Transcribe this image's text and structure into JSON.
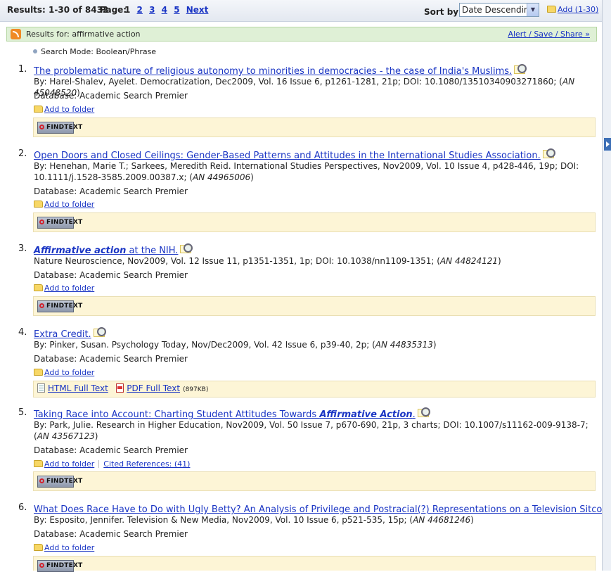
{
  "topbar": {
    "results_label": "Results: 1-30 of 8432",
    "page_label": "Page:",
    "pages": [
      "1",
      "2",
      "3",
      "4",
      "5"
    ],
    "next_label": "Next",
    "sort_label": "Sort by:",
    "sort_value": "Date Descending",
    "add_label": "Add (1-30)"
  },
  "results_for": {
    "label": "Results for:",
    "query": "affirmative action",
    "alert_label": "Alert / Save / Share »"
  },
  "search_mode": "Search Mode: Boolean/Phrase",
  "labels": {
    "database_prefix": "Database:",
    "add_to_folder": "Add to folder",
    "find_text": "FINDTEXT",
    "html_full_text": "HTML Full Text",
    "pdf_full_text": "PDF Full Text",
    "pdf_size": "(897KB)",
    "cited_references": "Cited References: (41)"
  },
  "results": [
    {
      "num": "1.",
      "title": "The problematic nature of religious autonomy to minorities in democracies - the case of India's Muslims.",
      "cite": "By: Harel-Shalev, Ayelet. Democratization, Dec2009, Vol. 16 Issue 6, p1261-1281, 21p; DOI: 10.1080/13510340903271860; (",
      "an": "AN 45048520",
      "database": "Academic Search Premier"
    },
    {
      "num": "2.",
      "title": "Open Doors and Closed Ceilings: Gender-Based Patterns and Attitudes in the International Studies Association.",
      "cite": "By: Henehan, Marie T.; Sarkees, Meredith Reid. International Studies Perspectives, Nov2009, Vol. 10 Issue 4, p428-446, 19p; DOI: 10.1111/j.1528-3585.2009.00387.x; (",
      "an": "AN 44965006",
      "database": "Academic Search Premier"
    },
    {
      "num": "3.",
      "title_hl": "Affirmative action",
      "title_rest": " at the NIH.",
      "cite": "Nature Neuroscience, Nov2009, Vol. 12 Issue 11, p1351-1351, 1p; DOI: 10.1038/nn1109-1351; (",
      "an": "AN 44824121",
      "database": "Academic Search Premier"
    },
    {
      "num": "4.",
      "title": "Extra Credit.",
      "cite": "By: Pinker, Susan. Psychology Today, Nov/Dec2009, Vol. 42 Issue 6, p39-40, 2p; (",
      "an": "AN 44835313",
      "database": "Academic Search Premier"
    },
    {
      "num": "5.",
      "title_pre": "Taking Race into Account: Charting Student Attitudes Towards ",
      "title_hl": "Affirmative Action",
      "title_rest": ".",
      "cite": "By: Park, Julie. Research in Higher Education, Nov2009, Vol. 50 Issue 7, p670-690, 21p, 3 charts; DOI: 10.1007/s11162-009-9138-7; (",
      "an": "AN 43567123",
      "database": "Academic Search Premier"
    },
    {
      "num": "6.",
      "title": "What Does Race Have to Do with Ugly Betty? An Analysis of Privilege and Postracial(?) Representations on a Television Sitcom.",
      "cite": "By: Esposito, Jennifer. Television & New Media, Nov2009, Vol. 10 Issue 6, p521-535, 15p; (",
      "an": "AN 44681246",
      "database": "Academic Search Premier"
    }
  ],
  "close_paren": ")",
  "icons": {
    "rss": "rss-feed-icon",
    "folder": "folder-icon",
    "preview": "magnifier-preview-icon",
    "findtext": "findtext-logo-icon",
    "html": "html-document-icon",
    "pdf": "pdf-document-icon"
  }
}
